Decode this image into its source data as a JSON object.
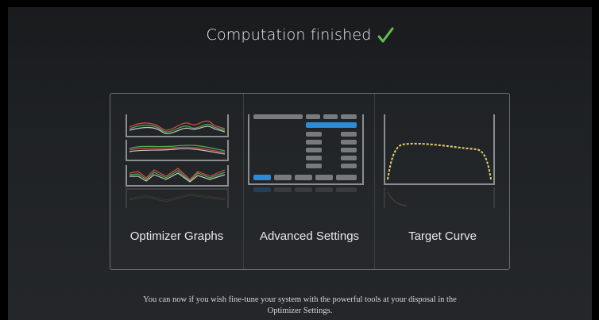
{
  "header": {
    "title": "Computation finished",
    "status_icon": "checkmark-icon",
    "status_color": "#5fc04a"
  },
  "options": [
    {
      "label": "Optimizer Graphs",
      "icon": "optimizer-graphs-thumbnail"
    },
    {
      "label": "Advanced Settings",
      "icon": "advanced-settings-thumbnail"
    },
    {
      "label": "Target Curve",
      "icon": "target-curve-thumbnail"
    }
  ],
  "footer": {
    "line1": "You can now if you wish fine-tune your system with the powerful tools at your disposal in the",
    "line2": "Optimizer Settings."
  },
  "colors": {
    "accent_blue": "#2a8bd8",
    "curve_yellow": "#e8d36a",
    "panel_border": "#6c6f73"
  }
}
